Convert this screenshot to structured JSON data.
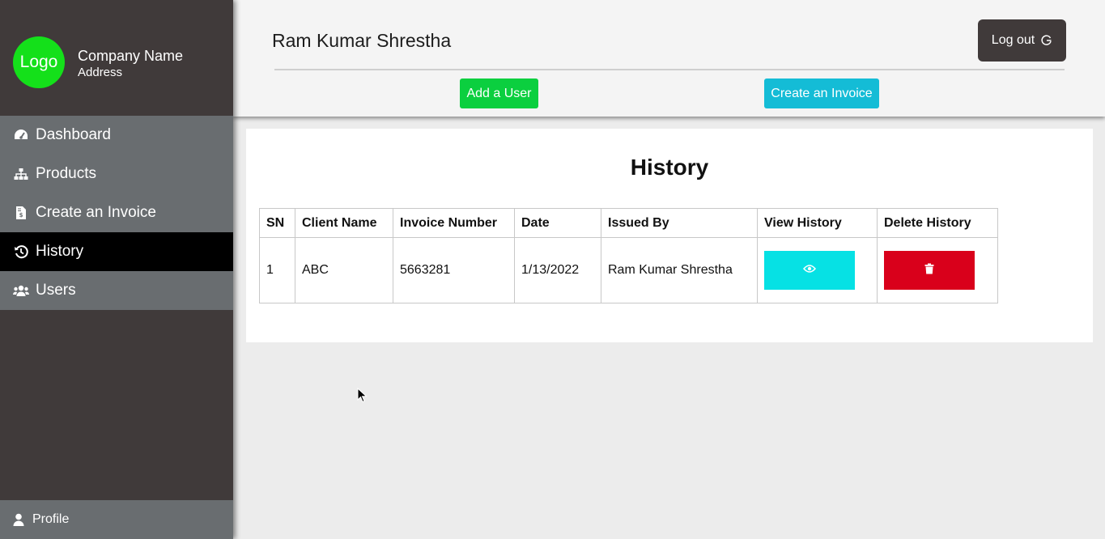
{
  "sidebar": {
    "logo_text": "Logo",
    "company_name": "Company Name",
    "company_address": "Address",
    "items": [
      {
        "label": "Dashboard",
        "icon": "dashboard-icon"
      },
      {
        "label": "Products",
        "icon": "sitemap-icon"
      },
      {
        "label": "Create an Invoice",
        "icon": "invoice-file-icon"
      },
      {
        "label": "History",
        "icon": "history-icon",
        "active": true
      },
      {
        "label": "Users",
        "icon": "users-icon"
      }
    ],
    "profile_label": "Profile"
  },
  "header": {
    "user_name": "Ram Kumar Shrestha",
    "logout_label": "Log out",
    "add_user_label": "Add a User",
    "create_invoice_label": "Create an Invoice"
  },
  "main": {
    "title": "History",
    "table": {
      "headers": [
        "SN",
        "Client Name",
        "Invoice Number",
        "Date",
        "Issued By",
        "View History",
        "Delete History"
      ],
      "rows": [
        {
          "sn": "1",
          "client": "ABC",
          "invoice_number": "5663281",
          "date": "1/13/2022",
          "issued_by": "Ram Kumar Shrestha"
        }
      ]
    }
  },
  "colors": {
    "sidebar_bg": "#403a3a",
    "nav_item_bg": "#696d70",
    "nav_active_bg": "#000000",
    "logo_bg": "#14e01a",
    "add_user_bg": "#0bcf3f",
    "create_invoice_bg": "#14bcd6",
    "view_bg": "#06e1e4",
    "delete_bg": "#d9001b"
  }
}
